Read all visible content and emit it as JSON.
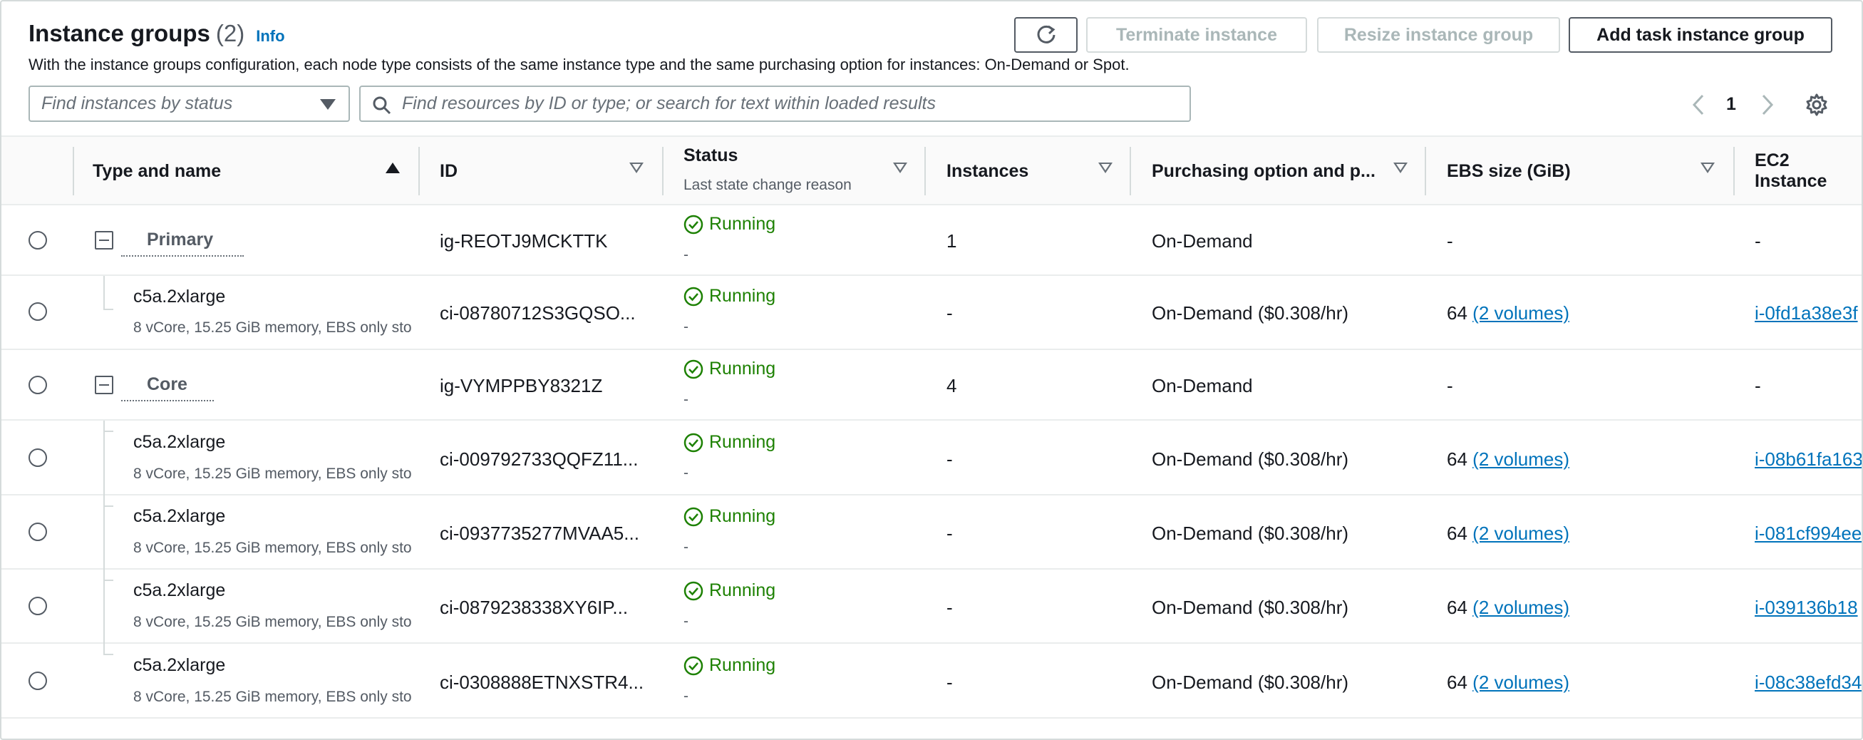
{
  "header": {
    "title": "Instance groups",
    "count": "(2)",
    "info": "Info",
    "description": "With the instance groups configuration, each node type consists of the same instance type and the same purchasing option for instances: On-Demand or Spot."
  },
  "actions": {
    "terminate": "Terminate instance",
    "resize": "Resize instance group",
    "add": "Add task instance group"
  },
  "filters": {
    "status_placeholder": "Find instances by status",
    "search_placeholder": "Find resources by ID or type; or search for text within loaded results"
  },
  "pagination": {
    "current_page": "1"
  },
  "columns": {
    "type_name": "Type and name",
    "id": "ID",
    "status": "Status",
    "status_sub": "Last state change reason",
    "instances": "Instances",
    "purchasing": "Purchasing option and p...",
    "ebs": "EBS size (GiB)",
    "ec2": "EC2 Instance"
  },
  "rows": [
    {
      "kind": "group",
      "name": "Primary",
      "id": "ig-REOTJ9MCKTTK",
      "status": "Running",
      "reason": "-",
      "instances": "1",
      "purchasing": "On-Demand",
      "ebs_size": "-",
      "ebs_link": "",
      "ec2": "-"
    },
    {
      "kind": "instance",
      "type": "c5a.2xlarge",
      "spec": "8 vCore, 15.25 GiB memory, EBS only sto",
      "id": "ci-08780712S3GQSO...",
      "status": "Running",
      "reason": "-",
      "instances": "-",
      "purchasing": "On-Demand ($0.308/hr)",
      "ebs_size": "64",
      "ebs_link": "(2 volumes)",
      "ec2": "i-0fd1a38e3f"
    },
    {
      "kind": "group",
      "name": "Core",
      "id": "ig-VYMPPBY8321Z",
      "status": "Running",
      "reason": "-",
      "instances": "4",
      "purchasing": "On-Demand",
      "ebs_size": "-",
      "ebs_link": "",
      "ec2": "-"
    },
    {
      "kind": "instance",
      "type": "c5a.2xlarge",
      "spec": "8 vCore, 15.25 GiB memory, EBS only sto",
      "id": "ci-009792733QQFZ11...",
      "status": "Running",
      "reason": "-",
      "instances": "-",
      "purchasing": "On-Demand ($0.308/hr)",
      "ebs_size": "64",
      "ebs_link": "(2 volumes)",
      "ec2": "i-08b61fa163"
    },
    {
      "kind": "instance",
      "type": "c5a.2xlarge",
      "spec": "8 vCore, 15.25 GiB memory, EBS only sto",
      "id": "ci-0937735277MVAA5...",
      "status": "Running",
      "reason": "-",
      "instances": "-",
      "purchasing": "On-Demand ($0.308/hr)",
      "ebs_size": "64",
      "ebs_link": "(2 volumes)",
      "ec2": "i-081cf994ee"
    },
    {
      "kind": "instance",
      "type": "c5a.2xlarge",
      "spec": "8 vCore, 15.25 GiB memory, EBS only sto",
      "id": "ci-0879238338XY6IP...",
      "status": "Running",
      "reason": "-",
      "instances": "-",
      "purchasing": "On-Demand ($0.308/hr)",
      "ebs_size": "64",
      "ebs_link": "(2 volumes)",
      "ec2": "i-039136b18"
    },
    {
      "kind": "instance",
      "type": "c5a.2xlarge",
      "spec": "8 vCore, 15.25 GiB memory, EBS only sto",
      "id": "ci-0308888ETNXSTR4...",
      "status": "Running",
      "reason": "-",
      "instances": "-",
      "purchasing": "On-Demand ($0.308/hr)",
      "ebs_size": "64",
      "ebs_link": "(2 volumes)",
      "ec2": "i-08c38efd34"
    }
  ],
  "colors": {
    "running": "#1d8102",
    "link": "#0073bb",
    "header_bg": "#fafafa"
  }
}
